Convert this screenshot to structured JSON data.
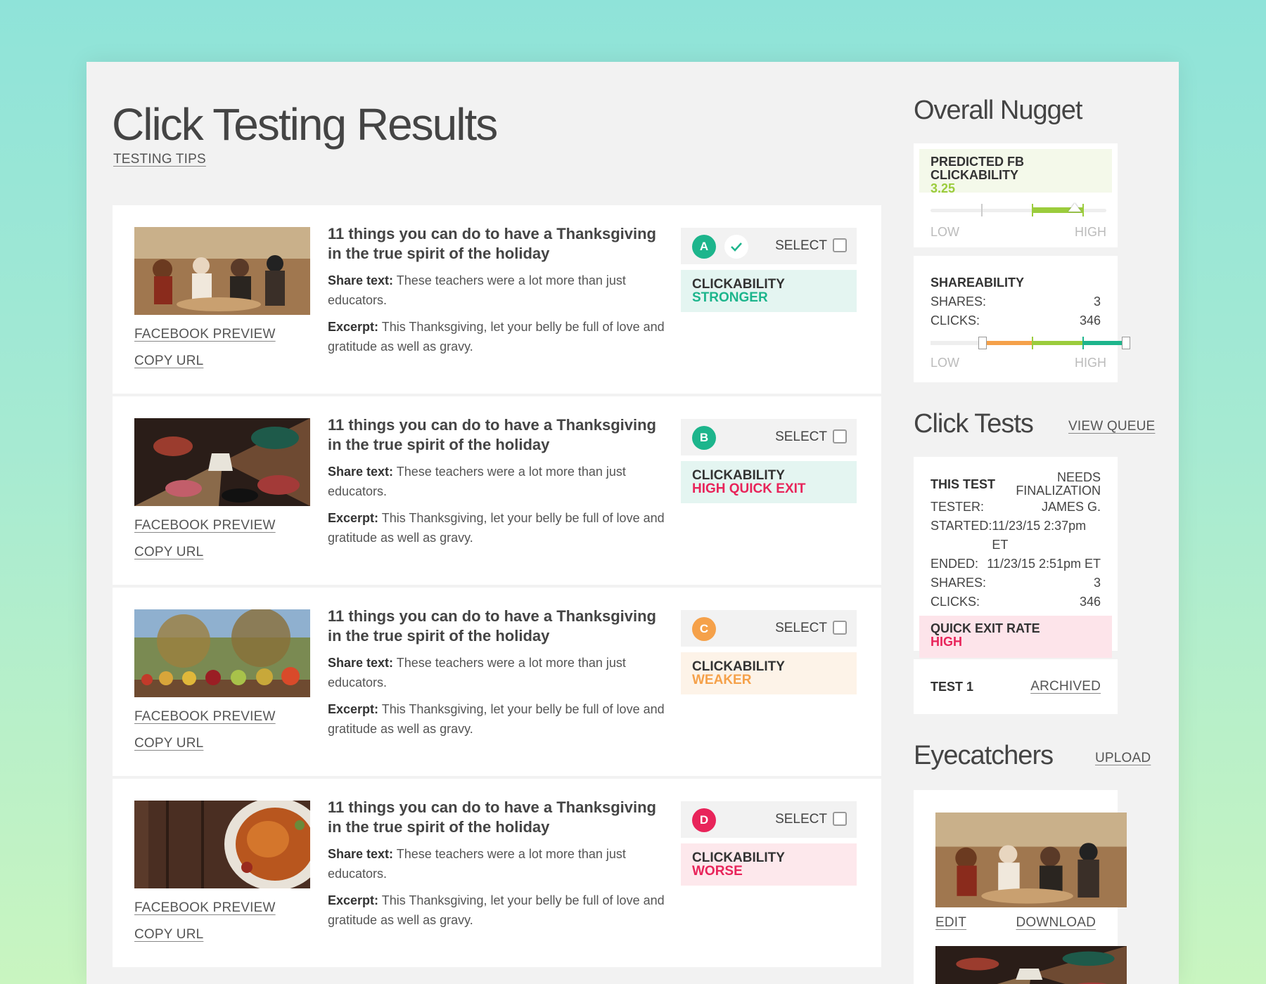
{
  "page": {
    "title": "Click Testing Results",
    "testing_tips": "TESTING TIPS"
  },
  "variants": [
    {
      "letter": "A",
      "badge_color": "#1db58c",
      "selected_winner": true,
      "headline": "11 things you can do to have a Thanksgiving in the true spirit of the holiday",
      "share_label": "Share text:",
      "share_text": "These teachers were a lot more than just educators.",
      "excerpt_label": "Excerpt:",
      "excerpt_text": "This Thanksgiving, let your belly be full of love and gratitude as well as gravy.",
      "facebook_preview": "FACEBOOK PREVIEW",
      "copy_url": "COPY URL",
      "select": "SELECT",
      "clickability_label": "CLICKABILITY",
      "clickability_value": "STRONGER",
      "clickability_color": "#1db58c",
      "clickability_bg": "#e4f5f1",
      "image": "pilgrims-painting"
    },
    {
      "letter": "B",
      "badge_color": "#1db58c",
      "selected_winner": false,
      "headline": "11 things you can do to have a Thanksgiving in the true spirit of the holiday",
      "share_label": "Share text:",
      "share_text": "These teachers were a lot more than just educators.",
      "excerpt_label": "Excerpt:",
      "excerpt_text": "This Thanksgiving, let your belly be full of love and gratitude as well as gravy.",
      "facebook_preview": "FACEBOOK PREVIEW",
      "copy_url": "COPY URL",
      "select": "SELECT",
      "clickability_label": "CLICKABILITY",
      "clickability_value": "HIGH QUICK EXIT",
      "clickability_color": "#e8245a",
      "clickability_bg": "#e4f5f1",
      "image": "shoes-circle"
    },
    {
      "letter": "C",
      "badge_color": "#f5a14a",
      "selected_winner": false,
      "headline": "11 things you can do to have a Thanksgiving in the true spirit of the holiday",
      "share_label": "Share text:",
      "share_text": "These teachers were a lot more than just educators.",
      "excerpt_label": "Excerpt:",
      "excerpt_text": "This Thanksgiving, let your belly be full of love and gratitude as well as gravy.",
      "facebook_preview": "FACEBOOK PREVIEW",
      "copy_url": "COPY URL",
      "select": "SELECT",
      "clickability_label": "CLICKABILITY",
      "clickability_value": "WEAKER",
      "clickability_color": "#f5a14a",
      "clickability_bg": "#fdf3e8",
      "image": "apples-row"
    },
    {
      "letter": "D",
      "badge_color": "#e8245a",
      "selected_winner": false,
      "headline": "11 things you can do to have a Thanksgiving in the true spirit of the holiday",
      "share_label": "Share text:",
      "share_text": "These teachers were a lot more than just educators.",
      "excerpt_label": "Excerpt:",
      "excerpt_text": "This Thanksgiving, let your belly be full of love and gratitude as well as gravy.",
      "facebook_preview": "FACEBOOK PREVIEW",
      "copy_url": "COPY URL",
      "select": "SELECT",
      "clickability_label": "CLICKABILITY",
      "clickability_value": "WORSE",
      "clickability_color": "#e8245a",
      "clickability_bg": "#fde8ec",
      "image": "roast-turkey"
    }
  ],
  "overall": {
    "title": "Overall Nugget",
    "predicted_label": "PREDICTED FB CLICKABILITY",
    "predicted_value": "3.25",
    "low": "LOW",
    "high": "HIGH",
    "shareability_label": "SHAREABILITY",
    "shares_label": "SHARES:",
    "shares_value": "3",
    "clicks_label": "CLICKS:",
    "clicks_value": "346"
  },
  "click_tests": {
    "title": "Click Tests",
    "view_queue": "VIEW QUEUE",
    "this_test": "THIS TEST",
    "status": "NEEDS FINALIZATION",
    "tester_label": "TESTER:",
    "tester": "JAMES G.",
    "started_label": "STARTED:",
    "started": "11/23/15 2:37pm ET",
    "ended_label": "ENDED:",
    "ended": "11/23/15 2:51pm ET",
    "shares_label": "SHARES:",
    "shares": "3",
    "clicks_label": "CLICKS:",
    "clicks": "346",
    "quick_exit_label": "QUICK EXIT RATE",
    "quick_exit_value": "HIGH",
    "test1": "TEST 1",
    "archived": "ARCHIVED"
  },
  "eyecatchers": {
    "title": "Eyecatchers",
    "upload": "UPLOAD",
    "edit": "EDIT",
    "download": "DOWNLOAD"
  }
}
